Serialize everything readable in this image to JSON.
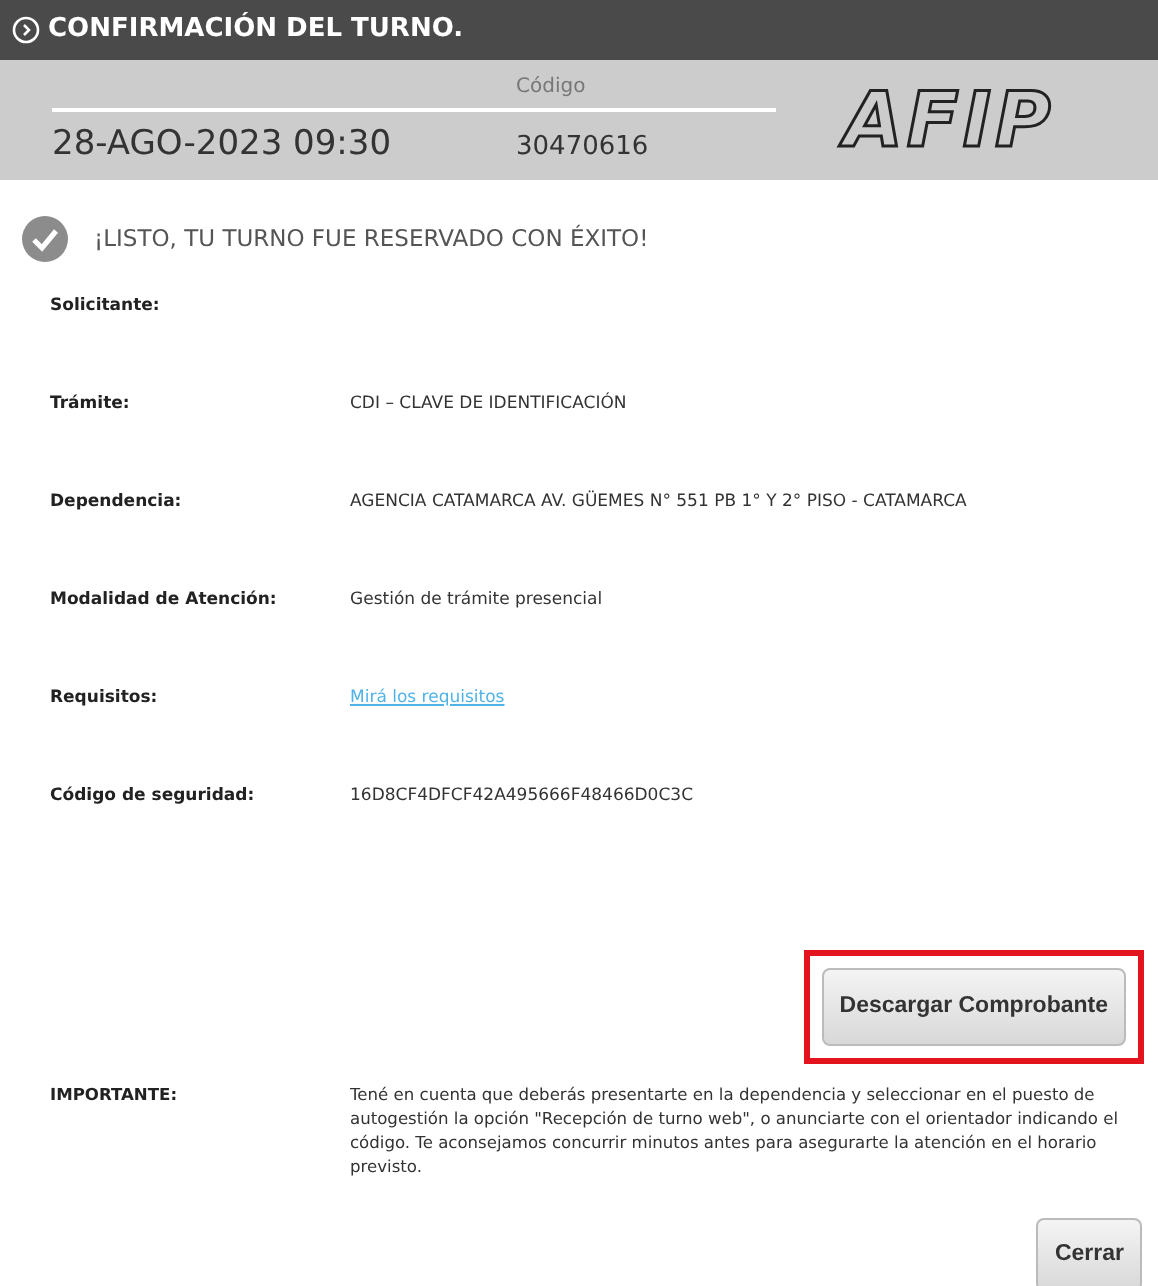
{
  "header": {
    "title": "CONFIRMACIÓN DEL TURNO."
  },
  "summary": {
    "datetime": "28-AGO-2023 09:30",
    "code_label": "Código",
    "code": "30470616",
    "logo": "AFIP"
  },
  "status": {
    "message": "¡LISTO, TU TURNO FUE RESERVADO CON ÉXITO!"
  },
  "fields": [
    {
      "label": "Solicitante:",
      "kind": "blank"
    },
    {
      "label": "Trámite:",
      "kind": "text",
      "value": "CDI – CLAVE DE IDENTIFICACIÓN"
    },
    {
      "label": "Dependencia:",
      "kind": "text",
      "value": "AGENCIA CATAMARCA AV. GÜEMES N° 551 PB 1° Y 2° PISO - CATAMARCA"
    },
    {
      "label": "Modalidad de Atención:",
      "kind": "text",
      "value": "Gestión de trámite presencial"
    },
    {
      "label": "Requisitos:",
      "kind": "link",
      "value": "Mirá los requisitos"
    },
    {
      "label": "Código de seguridad:",
      "kind": "text",
      "value": "16D8CF4DFCF42A495666F48466D0C3C"
    }
  ],
  "download_button": {
    "label": "Descargar Comprobante",
    "highlighted": true
  },
  "important": {
    "label": "IMPORTANTE:",
    "text": "Tené en cuenta que deberás presentarte en la dependencia y seleccionar en el puesto de autogestión la opción \"Recepción de turno web\", o anunciarte con el orientador indicando el código. Te aconsejamos concurrir minutos antes para asegurarte la atención en el horario previsto."
  },
  "close_button": {
    "label": "Cerrar"
  }
}
